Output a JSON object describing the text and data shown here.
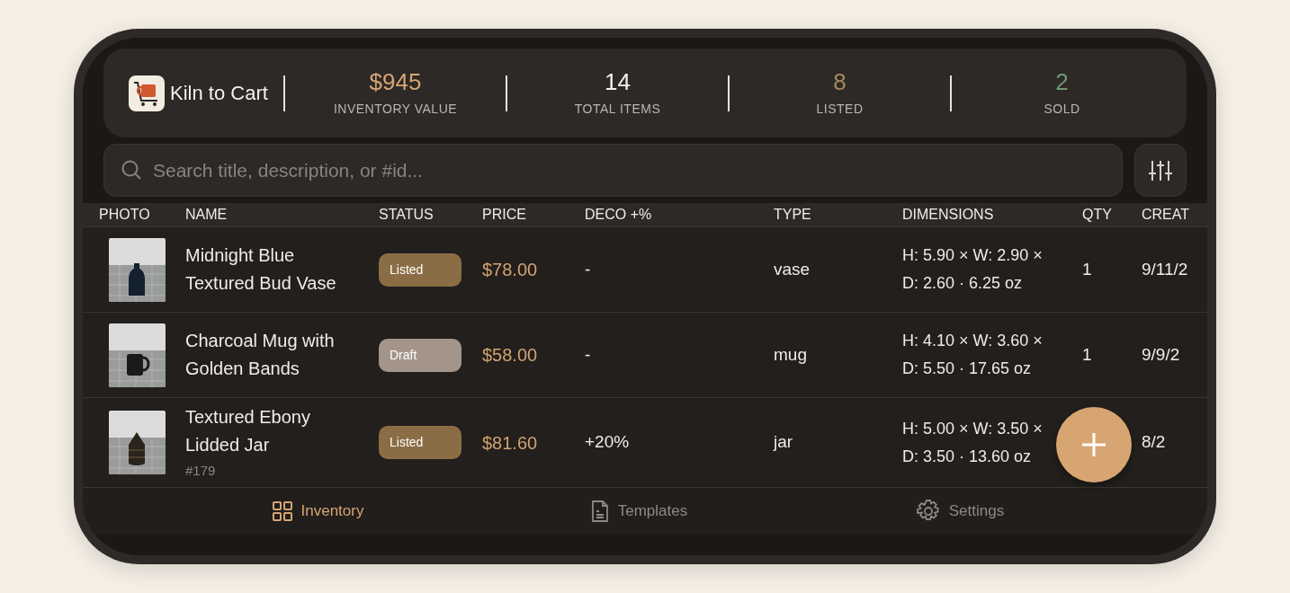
{
  "app": {
    "name": "Kiln to Cart"
  },
  "stats": [
    {
      "value": "$945",
      "label": "INVENTORY VALUE",
      "color": "#d6a571"
    },
    {
      "value": "14",
      "label": "TOTAL ITEMS",
      "color": "#f4f1ec"
    },
    {
      "value": "8",
      "label": "LISTED",
      "color": "#a8895c"
    },
    {
      "value": "2",
      "label": "SOLD",
      "color": "#6f9670"
    }
  ],
  "search": {
    "placeholder": "Search title, description, or #id..."
  },
  "table": {
    "columns": [
      "PHOTO",
      "NAME",
      "STATUS",
      "PRICE",
      "DECO +%",
      "TYPE",
      "DIMENSIONS",
      "QTY",
      "CREAT"
    ],
    "rows": [
      {
        "name": "Midnight Blue Textured Bud Vase",
        "status": {
          "label": "Listed",
          "kind": "listed"
        },
        "price": "$78.00",
        "deco": "-",
        "type": "vase",
        "dimensions": "H: 5.90 × W: 2.90 × D: 2.60 · 6.25 oz",
        "qty": "1",
        "created": "9/11/2",
        "kind": "vase"
      },
      {
        "name": "Charcoal Mug with Golden Bands",
        "status": {
          "label": "Draft",
          "kind": "draft"
        },
        "price": "$58.00",
        "deco": "-",
        "type": "mug",
        "dimensions": "H: 4.10 × W: 3.60 × D: 5.50 · 17.65 oz",
        "qty": "1",
        "created": "9/9/2",
        "kind": "mug"
      },
      {
        "name": "Textured Ebony Lidded Jar",
        "id": "#179",
        "status": {
          "label": "Listed",
          "kind": "listed"
        },
        "price": "$81.60",
        "deco": "+20%",
        "type": "jar",
        "dimensions": "H: 5.00 × W: 3.50 × D: 3.50 · 13.60 oz",
        "created": "8/2",
        "kind": "jar"
      }
    ]
  },
  "tabs": [
    {
      "label": "Inventory",
      "selected": true,
      "kind": "grid"
    },
    {
      "label": "Templates",
      "selected": false,
      "kind": "document"
    },
    {
      "label": "Settings",
      "selected": false,
      "kind": "gear"
    }
  ]
}
